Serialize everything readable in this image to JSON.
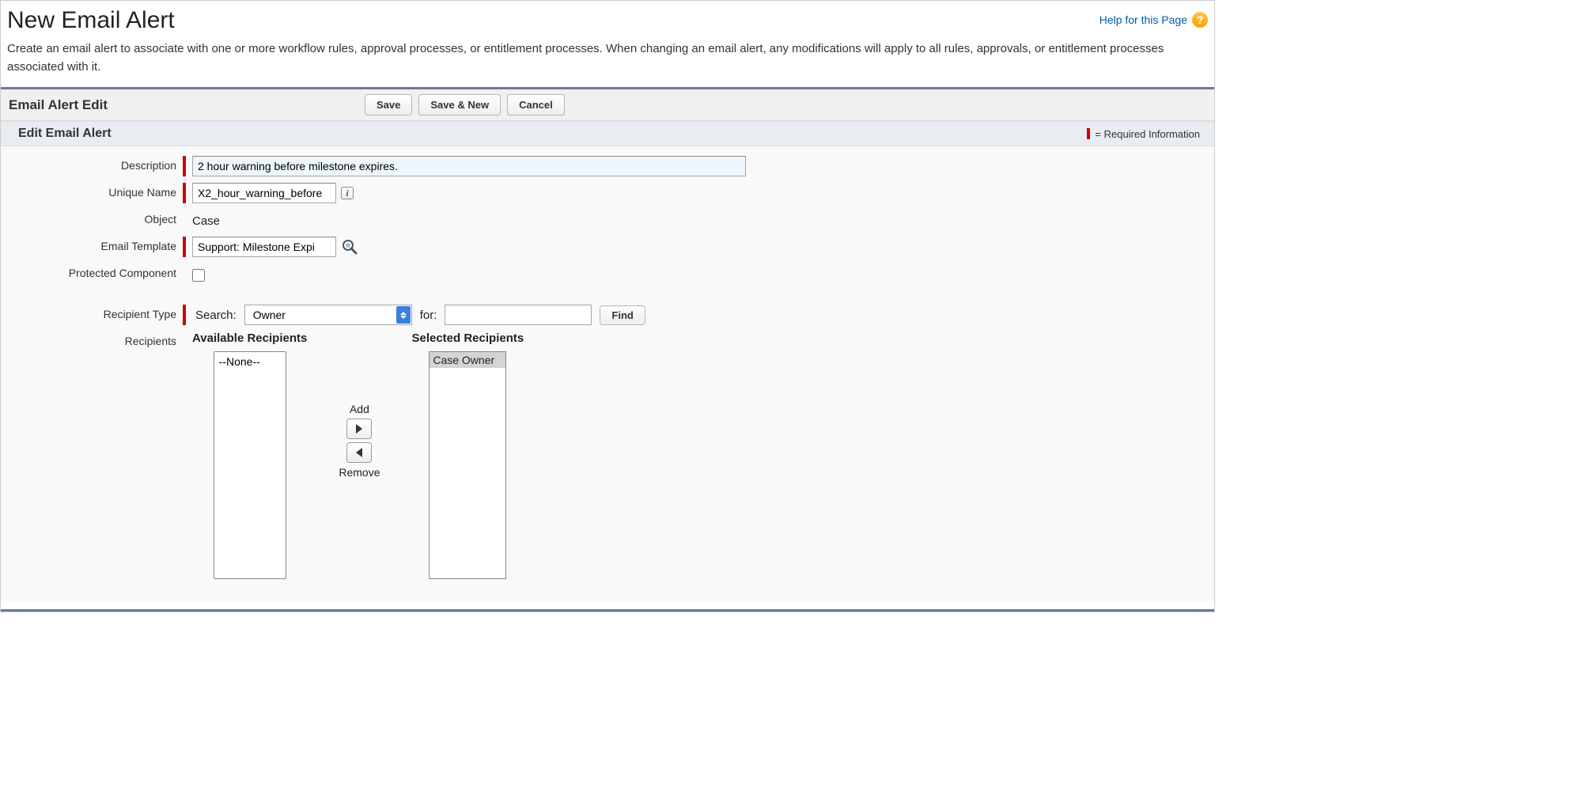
{
  "header": {
    "title": "New Email Alert",
    "help_link": "Help for this Page"
  },
  "intro": "Create an email alert to associate with one or more workflow rules, approval processes, or entitlement processes. When changing an email alert, any modifications will apply to all rules, approvals, or entitlement processes associated with it.",
  "section": {
    "title": "Email Alert Edit",
    "buttons": {
      "save": "Save",
      "save_new": "Save & New",
      "cancel": "Cancel"
    }
  },
  "subheader": {
    "title": "Edit Email Alert",
    "required_note": "= Required Information"
  },
  "fields": {
    "description": {
      "label": "Description",
      "value": "2 hour warning before milestone expires."
    },
    "unique_name": {
      "label": "Unique Name",
      "value": "X2_hour_warning_before"
    },
    "object": {
      "label": "Object",
      "value": "Case"
    },
    "email_template": {
      "label": "Email Template",
      "value": "Support: Milestone Expi"
    },
    "protected_component": {
      "label": "Protected Component",
      "checked": false
    },
    "recipient_type": {
      "label": "Recipient Type",
      "search_label": "Search:",
      "selected_option": "Owner",
      "for_label": "for:",
      "for_value": "",
      "find_button": "Find"
    },
    "recipients": {
      "label": "Recipients",
      "available_title": "Available Recipients",
      "available_items": [
        "--None--"
      ],
      "selected_title": "Selected Recipients",
      "selected_items": [
        "Case Owner"
      ],
      "add_label": "Add",
      "remove_label": "Remove"
    }
  }
}
